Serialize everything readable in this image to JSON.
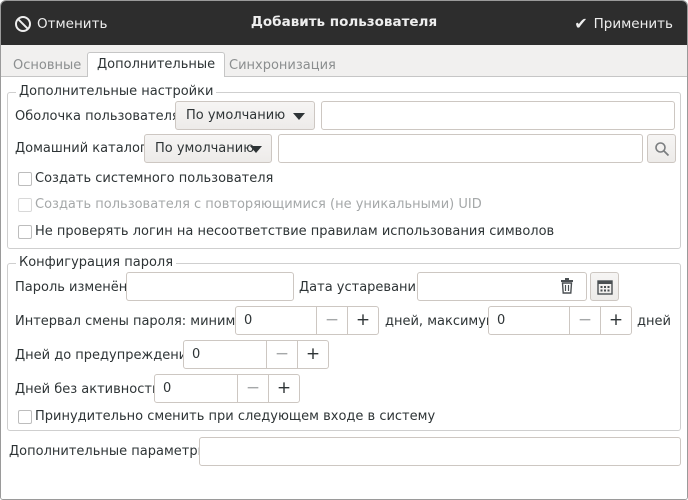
{
  "headerbar": {
    "cancel_label": "Отменить",
    "title": "Добавить пользователя",
    "apply_label": "Применить"
  },
  "tabs": [
    {
      "label": "Основные",
      "active": false
    },
    {
      "label": "Дополнительные",
      "active": true
    },
    {
      "label": "Синхронизация",
      "active": false
    }
  ],
  "advanced": {
    "legend": "Дополнительные настройки",
    "shell_label": "Оболочка пользователя:",
    "shell_selected": "По умолчанию",
    "shell_value": "",
    "home_label": "Домашний каталог:",
    "home_selected": "По умолчанию",
    "home_value": "",
    "system_user_label": "Создать системного пользователя",
    "non_unique_uid_label": "Создать пользователя с повторяющимися (не уникальными) UID",
    "skip_login_check_label": "Не проверять логин на несоответствие правилам использования символов"
  },
  "password": {
    "legend": "Конфигурация пароля",
    "changed_label": "Пароль изменён:",
    "changed_value": "",
    "expire_label": "Дата устаревания:",
    "expire_value": "",
    "interval_label": "Интервал смены пароля: минимум",
    "interval_min": "0",
    "interval_days_max_label": "дней, максимум",
    "interval_max": "0",
    "interval_days_label": "дней",
    "warn_label": "Дней до предупреждения:",
    "warn_value": "0",
    "inactive_label": "Дней без активности:",
    "inactive_value": "0",
    "force_change_label": "Принудительно сменить при следующем входе в систему"
  },
  "extra": {
    "label": "Дополнительные параметры:",
    "value": ""
  },
  "icons": {
    "cancel": "cancel-circle-icon",
    "apply": "checkmark-icon",
    "search": "search-icon",
    "trash": "trash-icon",
    "calendar": "calendar-icon",
    "minus": "minus-icon",
    "plus": "plus-icon",
    "dropdown": "chevron-down-icon"
  }
}
